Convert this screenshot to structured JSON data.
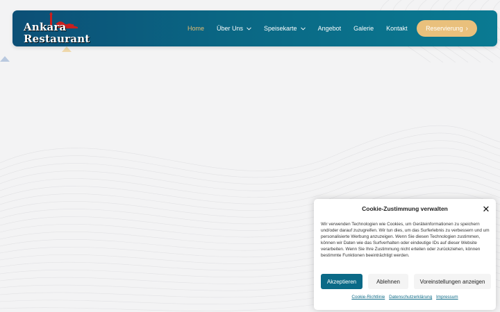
{
  "logo": {
    "line1": "Ankara",
    "line2": "Restaurant"
  },
  "nav": {
    "items": [
      {
        "label": "Home",
        "active": true,
        "dropdown": false
      },
      {
        "label": "Über Uns",
        "active": false,
        "dropdown": true
      },
      {
        "label": "Speisekarte",
        "active": false,
        "dropdown": true
      },
      {
        "label": "Angebot",
        "active": false,
        "dropdown": false
      },
      {
        "label": "Galerie",
        "active": false,
        "dropdown": false
      },
      {
        "label": "Kontakt",
        "active": false,
        "dropdown": false
      }
    ],
    "cta_label": "Reservierung"
  },
  "cookie": {
    "title": "Cookie-Zustimmung verwalten",
    "text": "Wir verwenden Technologien wie Cookies, um Geräteinformationen zu speichern und/oder darauf zuzugreifen. Wir tun dies, um das Surferlebnis zu verbessern und um personalisierte Werbung anzuzeigen. Wenn Sie diesen Technologien zustimmen, können wir Daten wie das Surfverhalten oder eindeutige IDs auf dieser Website verarbeiten. Wenn Sie Ihre Zustimmung nicht erteilen oder zurückziehen, können bestimmte Funktionen beeinträchtigt werden.",
    "accept_label": "Akzeptieren",
    "deny_label": "Ablehnen",
    "prefs_label": "Voreinstellungen anzeigen",
    "links": [
      "Cookie-Richtlinie",
      "Datenschutzerklärung",
      "Impressum"
    ]
  },
  "colors": {
    "nav_start": "#0c4f76",
    "nav_end": "#0a7a92",
    "active_link": "#e6bd72",
    "cta": "#e9c07c",
    "accept": "#0b6a87"
  }
}
